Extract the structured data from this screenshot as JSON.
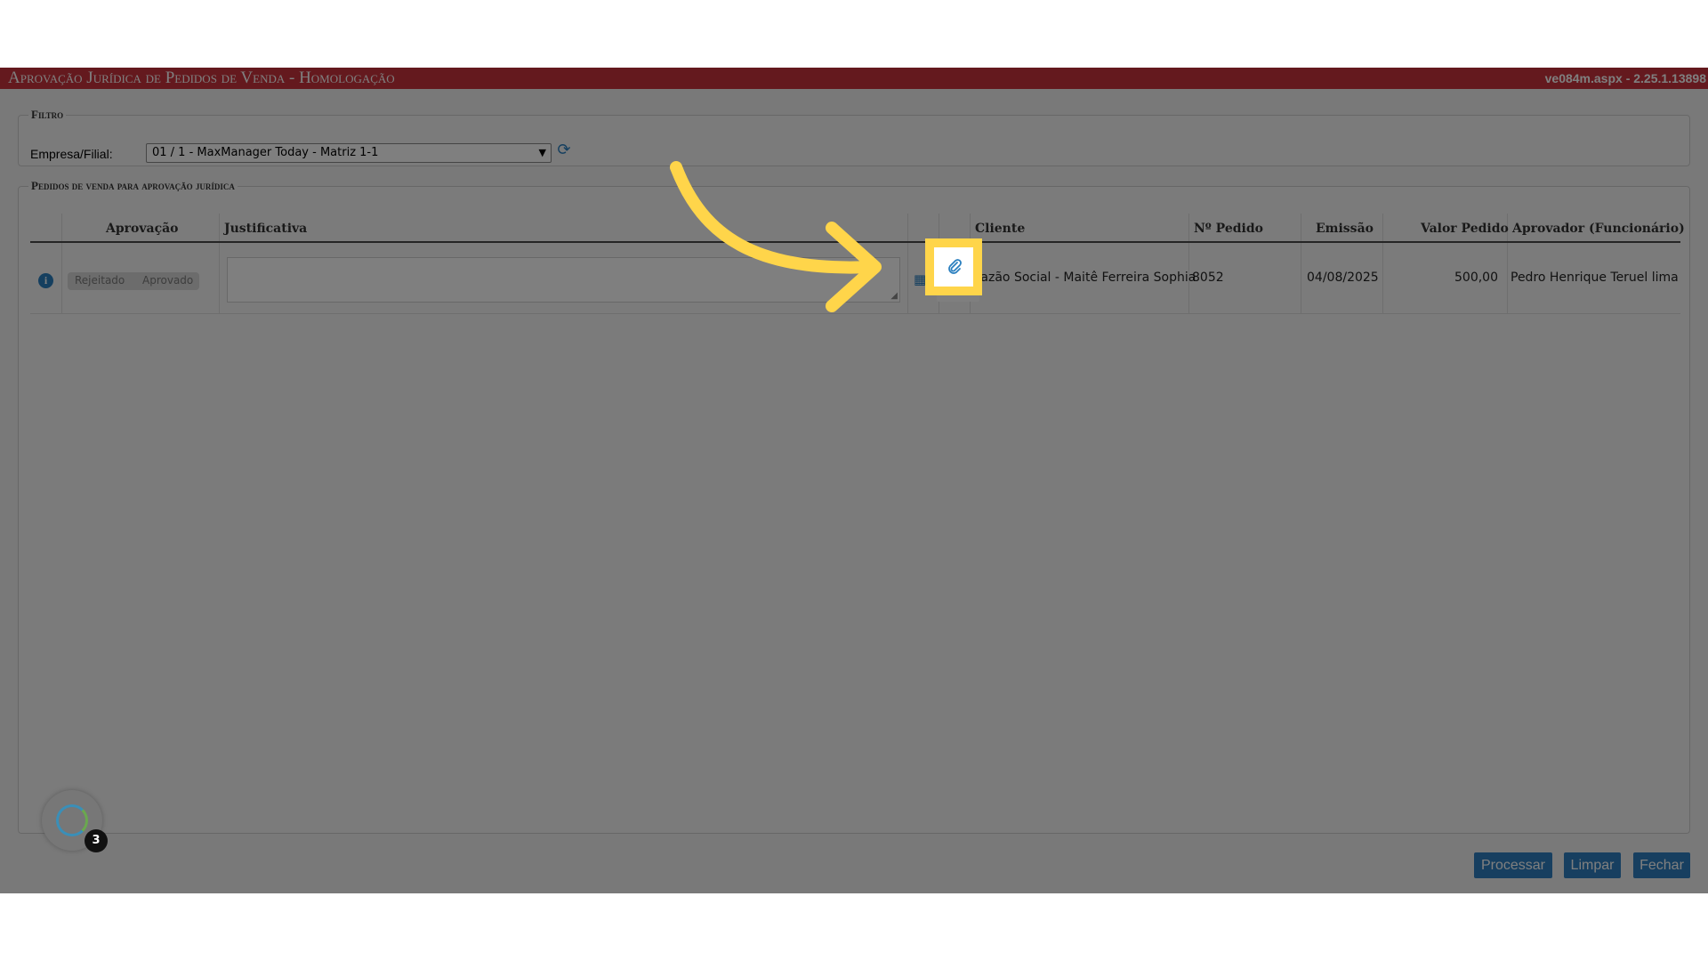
{
  "window": {
    "title": "Aprovação Jurídica de Pedidos de Venda  - Homologação",
    "version": "ve084m.aspx - 2.25.1.13898"
  },
  "filtro": {
    "legend": "Filtro",
    "empresa_label": "Empresa/Filial:",
    "empresa_value": "01 / 1 - MaxManager Today - Matriz 1-1"
  },
  "pedidos": {
    "legend": "Pedidos de venda para aprovação jurídica",
    "columns": [
      "Aprovação",
      "Justificativa",
      "Cliente",
      "Nº Pedido",
      "Emissão",
      "Valor Pedido",
      "Aprovador (Funcionário)"
    ],
    "rows": [
      {
        "toggle_rejeitado": "Rejeitado",
        "toggle_aprovado": "Aprovado",
        "cliente": "Razão Social - Maitê Ferreira Sophia",
        "pedido": "8052",
        "emissao": "04/08/2025",
        "valor": "500,00",
        "aprovador": "Pedro Henrique Teruel lima"
      }
    ]
  },
  "buttons": {
    "processar": "Processar",
    "limpar": "Limpar",
    "fechar": "Fechar"
  },
  "assistant": {
    "badge_count": "3"
  },
  "colors": {
    "title_bar": "#c8323c",
    "button": "#2f7fc0",
    "highlight": "#ffd54a"
  }
}
